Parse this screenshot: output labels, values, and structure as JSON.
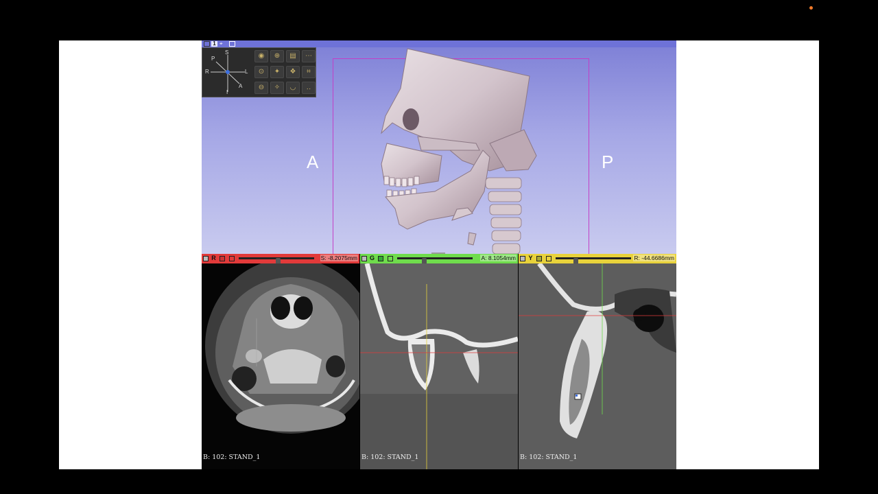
{
  "layout_number": "1",
  "view3d": {
    "orientation_left": "A",
    "orientation_right": "P",
    "axes": {
      "s": "S",
      "p": "P",
      "r": "R",
      "l": "L",
      "a": "A",
      "i": "I"
    }
  },
  "slices": {
    "red": {
      "letter": "R",
      "value": "S: -8.2075mm",
      "footer": "B: 102: STAND_1",
      "slider_position": 0.53
    },
    "green": {
      "letter": "G",
      "value": "A: 8.1054mm",
      "footer": "B: 102: STAND_1",
      "slider_position": 0.35
    },
    "yellow": {
      "letter": "Y",
      "value": "R: -44.6686mm",
      "footer": "B: 102: STAND_1",
      "slider_position": 0.25
    }
  },
  "colors": {
    "red": "#e23a3a",
    "green": "#6fdc4c",
    "yellow": "#e8d23b",
    "view3d_bg": "#9fa1e4",
    "roi_box": "#c23fc6"
  }
}
